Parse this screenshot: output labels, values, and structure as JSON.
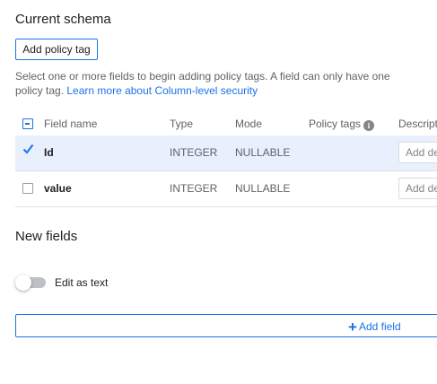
{
  "current_schema": {
    "title": "Current schema",
    "add_policy_tag_label": "Add policy tag",
    "help_text": "Select one or more fields to begin adding policy tags. A field can only have one policy tag.",
    "help_link": "Learn more about Column-level security"
  },
  "table": {
    "headers": {
      "name": "Field name",
      "type": "Type",
      "mode": "Mode",
      "policy_tags": "Policy tags",
      "description": "Descripti"
    },
    "rows": [
      {
        "name": "Id",
        "type": "INTEGER",
        "mode": "NULLABLE",
        "checked": true,
        "description_placeholder": "Add de"
      },
      {
        "name": "value",
        "type": "INTEGER",
        "mode": "NULLABLE",
        "checked": false,
        "description_placeholder": "Add de"
      }
    ]
  },
  "new_fields": {
    "title": "New fields",
    "edit_as_text_label": "Edit as text",
    "edit_as_text_on": false,
    "add_field_label": "Add field"
  },
  "colors": {
    "accent": "#1a73e8",
    "selected_row": "#e8f0fe"
  }
}
